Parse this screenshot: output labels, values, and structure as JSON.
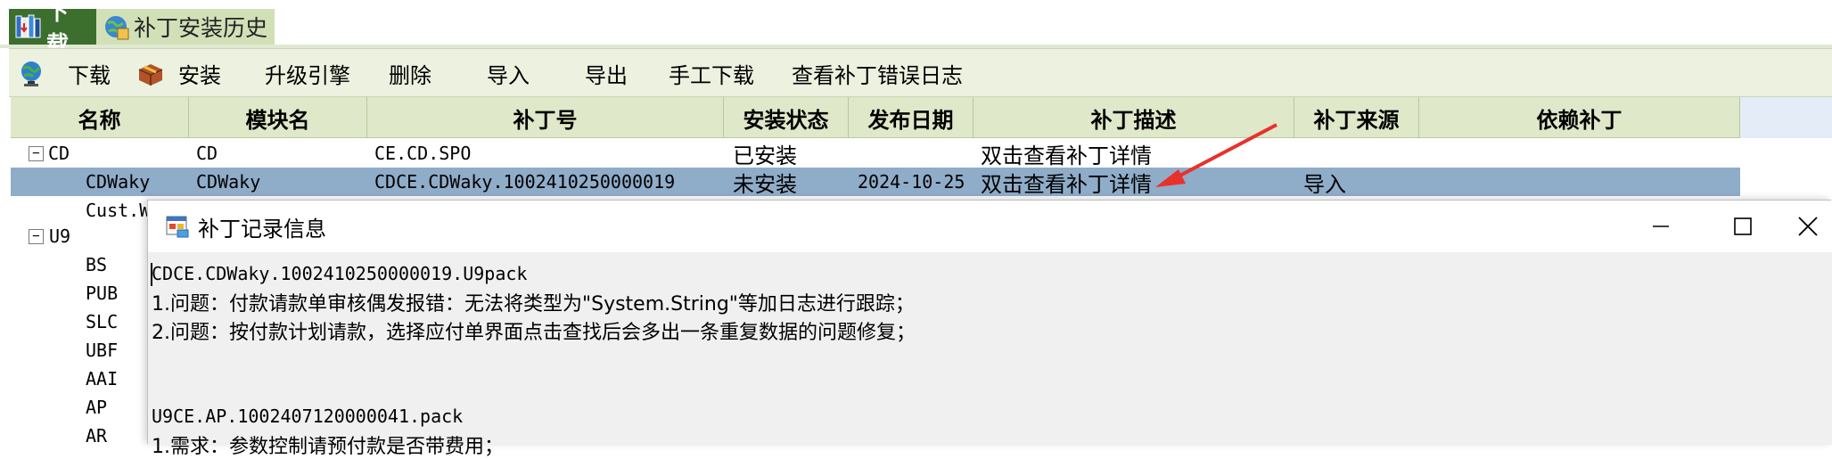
{
  "tabs": [
    {
      "label": "下载",
      "active": true,
      "icon": "download-books-icon"
    },
    {
      "label": "补丁安装历史",
      "active": false,
      "icon": "history-globe-icon"
    }
  ],
  "toolbar": {
    "download": "下载",
    "install": "安装",
    "upgrade_engine": "升级引擎",
    "delete": "删除",
    "import": "导入",
    "export": "导出",
    "manual_download": "手工下载",
    "view_error_log": "查看补丁错误日志"
  },
  "grid": {
    "columns": [
      "名称",
      "模块名",
      "补丁号",
      "安装状态",
      "发布日期",
      "补丁描述",
      "补丁来源",
      "依赖补丁"
    ],
    "rows": [
      {
        "name": "CD",
        "module": "CD",
        "patch": "CE.CD.SPO",
        "status": "已安装",
        "date": "",
        "desc": "双击查看补丁详情",
        "source": "",
        "expander": "−"
      },
      {
        "name": "CDWaky",
        "module": "CDWaky",
        "patch": "CDCE.CDWaky.1002410250000019",
        "status": "未安装",
        "date": "2024-10-25",
        "desc": "双击查看补丁详情",
        "source": "导入",
        "selected": true
      },
      {
        "name": "Cust.W",
        "module": "",
        "patch": "",
        "status": "",
        "date": "",
        "desc": "",
        "source": ""
      }
    ],
    "tree": [
      {
        "label": "U9",
        "expander": "−"
      },
      {
        "label": "BS"
      },
      {
        "label": "PUB"
      },
      {
        "label": "SLC"
      },
      {
        "label": "UBF"
      },
      {
        "label": "AAI"
      },
      {
        "label": "AP"
      },
      {
        "label": "AR"
      }
    ]
  },
  "dialog": {
    "title": "补丁记录信息",
    "lines": [
      "CDCE.CDWaky.1002410250000019.U9pack",
      "1.问题：付款请款单审核偶发报错：无法将类型为\"System.String\"等加日志进行跟踪；",
      "2.问题：按付款计划请款，选择应付单界面点击查找后会多出一条重复数据的问题修复；",
      "",
      "",
      "U9CE.AP.1002407120000041.pack",
      "1.需求：参数控制请预付款是否带费用；"
    ]
  },
  "colors": {
    "tab_active": "#3c6e2e",
    "tab_inactive": "#d2e0b8",
    "toolbar_bg": "#ecf1e0",
    "grid_header_bg": "#dfe8c8",
    "selected_row": "#8facc9",
    "annotation_arrow": "#e8312a"
  }
}
